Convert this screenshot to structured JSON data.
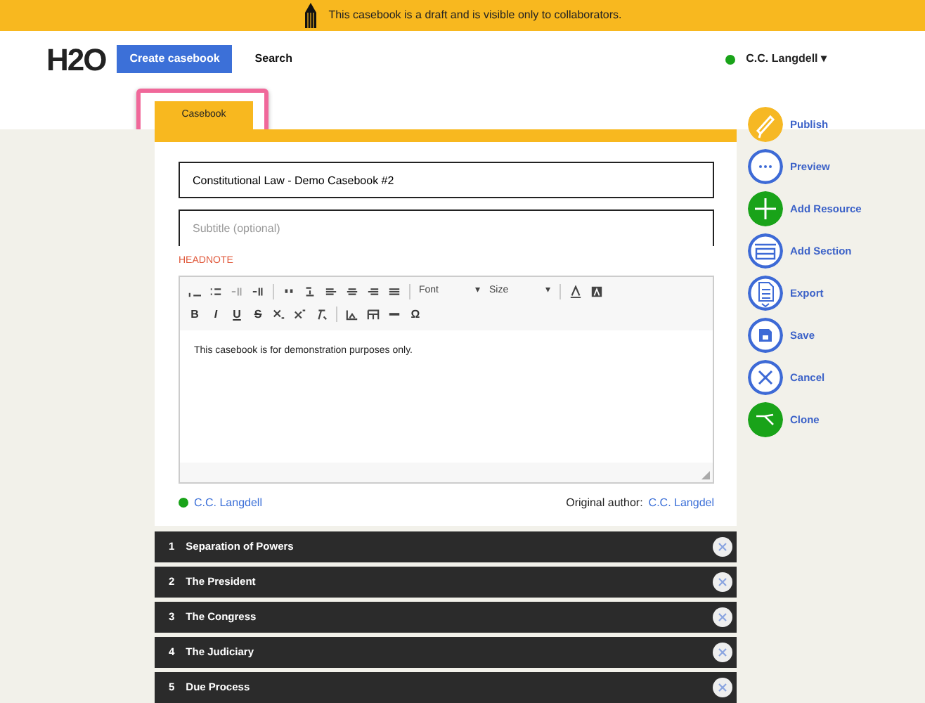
{
  "banner": {
    "text": "This casebook is a draft and is visible only to collaborators."
  },
  "header": {
    "logo": "H2O",
    "create_button": "Create casebook",
    "search_link": "Search",
    "user": {
      "name": "C.C. Langdell",
      "caret": "▾",
      "online": true
    }
  },
  "tab": {
    "label": "Casebook",
    "highlighted": true
  },
  "form": {
    "title_value": "Constitutional Law - Demo Casebook #2",
    "subtitle_placeholder": "Subtitle (optional)",
    "headnote_label": "HEADNOTE",
    "toolbar_dropdowns": [
      {
        "label": "Font",
        "caret": "▾"
      },
      {
        "label": "Size",
        "caret": "▾"
      }
    ],
    "format_buttons": [
      "B",
      "I",
      "U",
      "S"
    ],
    "special_char": "Ω",
    "editor_text": "This casebook is for demonstration purposes only.",
    "collaborator": {
      "name": "C.C. Langdell",
      "online": true
    },
    "original_author_label": "Original author:",
    "original_author": "C.C. Langdel"
  },
  "actions": [
    {
      "label": "Publish",
      "kind": "filled",
      "color": "#f6b824"
    },
    {
      "label": "Preview",
      "kind": "outline",
      "color": "#3d6ad6"
    },
    {
      "label": "Add Resource",
      "kind": "filled",
      "color": "#19a319"
    },
    {
      "label": "Add Section",
      "kind": "outline",
      "color": "#3d6ad6"
    },
    {
      "label": "Export",
      "kind": "outline",
      "color": "#3d6ad6"
    },
    {
      "label": "Save",
      "kind": "outline",
      "color": "#3d6ad6"
    },
    {
      "label": "Cancel",
      "kind": "outline",
      "color": "#3d6ad6"
    },
    {
      "label": "Clone",
      "kind": "filled",
      "color": "#19a319"
    }
  ],
  "chapters": [
    {
      "number": "1",
      "title": "Separation of Powers"
    },
    {
      "number": "2",
      "title": "The President"
    },
    {
      "number": "3",
      "title": "The Congress"
    },
    {
      "number": "4",
      "title": "The Judiciary"
    },
    {
      "number": "5",
      "title": "Due Process"
    }
  ]
}
